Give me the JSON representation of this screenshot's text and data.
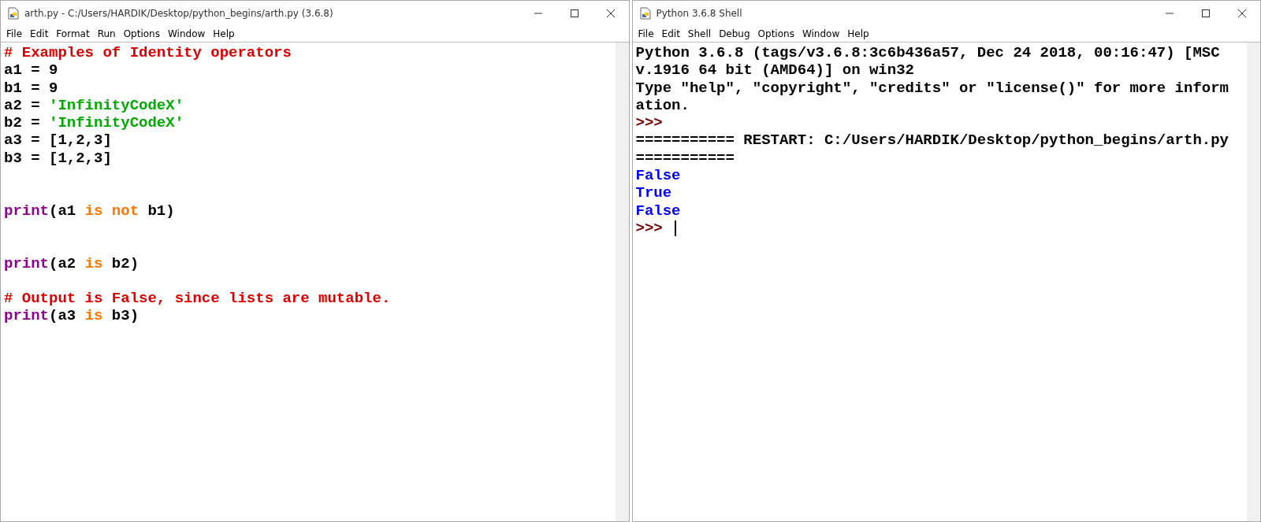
{
  "windows": [
    {
      "title": "arth.py - C:/Users/HARDIK/Desktop/python_begins/arth.py (3.6.8)",
      "menu": [
        "File",
        "Edit",
        "Format",
        "Run",
        "Options",
        "Window",
        "Help"
      ],
      "cursor": false,
      "lines": [
        {
          "kind": "code",
          "segments": [
            {
              "kind": "comment",
              "text": "# Examples of Identity operators"
            }
          ]
        },
        {
          "kind": "code",
          "segments": [
            {
              "kind": "plain",
              "text": "a1 = 9"
            }
          ]
        },
        {
          "kind": "code",
          "segments": [
            {
              "kind": "plain",
              "text": "b1 = 9"
            }
          ]
        },
        {
          "kind": "code",
          "segments": [
            {
              "kind": "plain",
              "text": "a2 = "
            },
            {
              "kind": "string",
              "text": "'InfinityCodeX'"
            }
          ]
        },
        {
          "kind": "code",
          "segments": [
            {
              "kind": "plain",
              "text": "b2 = "
            },
            {
              "kind": "string",
              "text": "'InfinityCodeX'"
            }
          ]
        },
        {
          "kind": "code",
          "segments": [
            {
              "kind": "plain",
              "text": "a3 = [1,2,3]"
            }
          ]
        },
        {
          "kind": "code",
          "segments": [
            {
              "kind": "plain",
              "text": "b3 = [1,2,3]"
            }
          ]
        },
        {
          "kind": "blank"
        },
        {
          "kind": "blank"
        },
        {
          "kind": "code",
          "segments": [
            {
              "kind": "builtin",
              "text": "print"
            },
            {
              "kind": "plain",
              "text": "(a1 "
            },
            {
              "kind": "keyword",
              "text": "is not"
            },
            {
              "kind": "plain",
              "text": " b1)"
            }
          ]
        },
        {
          "kind": "blank"
        },
        {
          "kind": "blank"
        },
        {
          "kind": "code",
          "segments": [
            {
              "kind": "builtin",
              "text": "print"
            },
            {
              "kind": "plain",
              "text": "(a2 "
            },
            {
              "kind": "keyword",
              "text": "is"
            },
            {
              "kind": "plain",
              "text": " b2)"
            }
          ]
        },
        {
          "kind": "blank"
        },
        {
          "kind": "code",
          "segments": [
            {
              "kind": "comment",
              "text": "# Output is False, since lists are mutable."
            }
          ]
        },
        {
          "kind": "code",
          "segments": [
            {
              "kind": "builtin",
              "text": "print"
            },
            {
              "kind": "plain",
              "text": "(a3 "
            },
            {
              "kind": "keyword",
              "text": "is"
            },
            {
              "kind": "plain",
              "text": " b3)"
            }
          ]
        }
      ]
    },
    {
      "title": "Python 3.6.8 Shell",
      "menu": [
        "File",
        "Edit",
        "Shell",
        "Debug",
        "Options",
        "Window",
        "Help"
      ],
      "cursor": true,
      "lines": [
        {
          "kind": "code",
          "segments": [
            {
              "kind": "plain",
              "text": "Python 3.6.8 (tags/v3.6.8:3c6b436a57, Dec 24 2018, 00:16:47) [MSC"
            }
          ]
        },
        {
          "kind": "code",
          "segments": [
            {
              "kind": "plain",
              "text": "v.1916 64 bit (AMD64)] on win32"
            }
          ]
        },
        {
          "kind": "code",
          "segments": [
            {
              "kind": "plain",
              "text": "Type \"help\", \"copyright\", \"credits\" or \"license()\" for more inform"
            }
          ]
        },
        {
          "kind": "code",
          "segments": [
            {
              "kind": "plain",
              "text": "ation."
            }
          ]
        },
        {
          "kind": "code",
          "segments": [
            {
              "kind": "prompt",
              "text": ">>>"
            }
          ]
        },
        {
          "kind": "code",
          "segments": [
            {
              "kind": "plain",
              "text": "=========== RESTART: C:/Users/HARDIK/Desktop/python_begins/arth.py"
            }
          ]
        },
        {
          "kind": "code",
          "segments": [
            {
              "kind": "plain",
              "text": "==========="
            }
          ]
        },
        {
          "kind": "code",
          "segments": [
            {
              "kind": "output",
              "text": "False"
            }
          ]
        },
        {
          "kind": "code",
          "segments": [
            {
              "kind": "output",
              "text": "True"
            }
          ]
        },
        {
          "kind": "code",
          "segments": [
            {
              "kind": "output",
              "text": "False"
            }
          ]
        },
        {
          "kind": "code",
          "segments": [
            {
              "kind": "prompt",
              "text": ">>> "
            }
          ]
        }
      ]
    }
  ]
}
